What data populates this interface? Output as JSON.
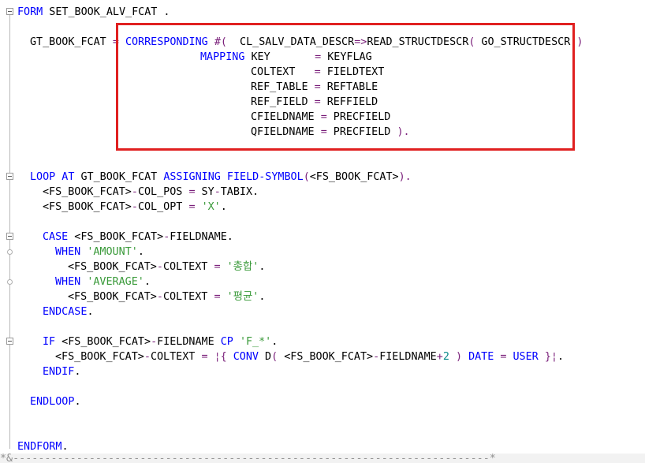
{
  "editor": {
    "lines": [
      {
        "indent": 22,
        "parts": [
          {
            "c": "k",
            "t": "FORM"
          },
          {
            "c": "t",
            "t": " SET_BOOK_ALV_FCAT ."
          }
        ]
      },
      {
        "indent": 38,
        "parts": [
          {
            "c": "t",
            "t": "GT_BOOK_FCAT "
          },
          {
            "c": "p",
            "t": "="
          },
          {
            "c": "t",
            "t": " "
          },
          {
            "c": "k",
            "t": "CORRESPONDING"
          },
          {
            "c": "t",
            "t": " "
          },
          {
            "c": "p",
            "t": "#("
          },
          {
            "c": "t",
            "t": "  CL_SALV_DATA_DESCR"
          },
          {
            "c": "p",
            "t": "=>"
          },
          {
            "c": "t",
            "t": "READ_STRUCTDESCR"
          },
          {
            "c": "p",
            "t": "("
          },
          {
            "c": "t",
            "t": " GO_STRUCTDESCR "
          },
          {
            "c": "p",
            "t": ")"
          }
        ]
      },
      {
        "indent": 254,
        "parts": [
          {
            "c": "k",
            "t": "MAPPING"
          },
          {
            "c": "t",
            "t": " KEY       "
          },
          {
            "c": "p",
            "t": "="
          },
          {
            "c": "t",
            "t": " KEYFLAG"
          }
        ]
      },
      {
        "indent": 318,
        "parts": [
          {
            "c": "t",
            "t": "COLTEXT   "
          },
          {
            "c": "p",
            "t": "="
          },
          {
            "c": "t",
            "t": " FIELDTEXT"
          }
        ]
      },
      {
        "indent": 318,
        "parts": [
          {
            "c": "t",
            "t": "REF_TABLE "
          },
          {
            "c": "p",
            "t": "="
          },
          {
            "c": "t",
            "t": " REFTABLE"
          }
        ]
      },
      {
        "indent": 318,
        "parts": [
          {
            "c": "t",
            "t": "REF_FIELD "
          },
          {
            "c": "p",
            "t": "="
          },
          {
            "c": "t",
            "t": " REFFIELD"
          }
        ]
      },
      {
        "indent": 318,
        "parts": [
          {
            "c": "t",
            "t": "CFIELDNAME "
          },
          {
            "c": "p",
            "t": "="
          },
          {
            "c": "t",
            "t": " PRECFIELD"
          }
        ]
      },
      {
        "indent": 318,
        "parts": [
          {
            "c": "t",
            "t": "QFIELDNAME "
          },
          {
            "c": "p",
            "t": "="
          },
          {
            "c": "t",
            "t": " PRECFIELD "
          },
          {
            "c": "p",
            "t": ")."
          }
        ]
      },
      {
        "indent": 38,
        "parts": [
          {
            "c": "k",
            "t": "LOOP AT"
          },
          {
            "c": "t",
            "t": " GT_BOOK_FCAT "
          },
          {
            "c": "k",
            "t": "ASSIGNING FIELD-SYMBOL"
          },
          {
            "c": "p",
            "t": "("
          },
          {
            "c": "t",
            "t": "<FS_BOOK_FCAT>"
          },
          {
            "c": "p",
            "t": ")."
          }
        ]
      },
      {
        "indent": 54,
        "parts": [
          {
            "c": "t",
            "t": "<FS_BOOK_FCAT>"
          },
          {
            "c": "p",
            "t": "-"
          },
          {
            "c": "t",
            "t": "COL_POS "
          },
          {
            "c": "p",
            "t": "="
          },
          {
            "c": "t",
            "t": " SY"
          },
          {
            "c": "p",
            "t": "-"
          },
          {
            "c": "t",
            "t": "TABIX."
          }
        ]
      },
      {
        "indent": 54,
        "parts": [
          {
            "c": "t",
            "t": "<FS_BOOK_FCAT>"
          },
          {
            "c": "p",
            "t": "-"
          },
          {
            "c": "t",
            "t": "COL_OPT "
          },
          {
            "c": "p",
            "t": "="
          },
          {
            "c": "t",
            "t": " "
          },
          {
            "c": "s",
            "t": "'X'"
          },
          {
            "c": "t",
            "t": "."
          }
        ]
      },
      {
        "indent": 54,
        "parts": [
          {
            "c": "k",
            "t": "CASE"
          },
          {
            "c": "t",
            "t": " <FS_BOOK_FCAT>"
          },
          {
            "c": "p",
            "t": "-"
          },
          {
            "c": "t",
            "t": "FIELDNAME."
          }
        ]
      },
      {
        "indent": 70,
        "parts": [
          {
            "c": "k",
            "t": "WHEN"
          },
          {
            "c": "t",
            "t": " "
          },
          {
            "c": "s",
            "t": "'AMOUNT'"
          },
          {
            "c": "t",
            "t": "."
          }
        ]
      },
      {
        "indent": 86,
        "parts": [
          {
            "c": "t",
            "t": "<FS_BOOK_FCAT>"
          },
          {
            "c": "p",
            "t": "-"
          },
          {
            "c": "t",
            "t": "COLTEXT "
          },
          {
            "c": "p",
            "t": "="
          },
          {
            "c": "t",
            "t": " "
          },
          {
            "c": "s",
            "t": "'총합'"
          },
          {
            "c": "t",
            "t": "."
          }
        ]
      },
      {
        "indent": 70,
        "parts": [
          {
            "c": "k",
            "t": "WHEN"
          },
          {
            "c": "t",
            "t": " "
          },
          {
            "c": "s",
            "t": "'AVERAGE'"
          },
          {
            "c": "t",
            "t": "."
          }
        ]
      },
      {
        "indent": 86,
        "parts": [
          {
            "c": "t",
            "t": "<FS_BOOK_FCAT>"
          },
          {
            "c": "p",
            "t": "-"
          },
          {
            "c": "t",
            "t": "COLTEXT "
          },
          {
            "c": "p",
            "t": "="
          },
          {
            "c": "t",
            "t": " "
          },
          {
            "c": "s",
            "t": "'평균'"
          },
          {
            "c": "t",
            "t": "."
          }
        ]
      },
      {
        "indent": 54,
        "parts": [
          {
            "c": "k",
            "t": "ENDCASE"
          },
          {
            "c": "t",
            "t": "."
          }
        ]
      },
      {
        "indent": 54,
        "parts": [
          {
            "c": "k",
            "t": "IF"
          },
          {
            "c": "t",
            "t": " <FS_BOOK_FCAT>"
          },
          {
            "c": "p",
            "t": "-"
          },
          {
            "c": "t",
            "t": "FIELDNAME "
          },
          {
            "c": "k",
            "t": "CP"
          },
          {
            "c": "t",
            "t": " "
          },
          {
            "c": "s",
            "t": "'F_*'"
          },
          {
            "c": "t",
            "t": "."
          }
        ]
      },
      {
        "indent": 70,
        "parts": [
          {
            "c": "t",
            "t": "<FS_BOOK_FCAT>"
          },
          {
            "c": "p",
            "t": "-"
          },
          {
            "c": "t",
            "t": "COLTEXT "
          },
          {
            "c": "p",
            "t": "="
          },
          {
            "c": "t",
            "t": " "
          },
          {
            "c": "p",
            "t": "¦{"
          },
          {
            "c": "t",
            "t": " "
          },
          {
            "c": "k",
            "t": "CONV"
          },
          {
            "c": "t",
            "t": " D"
          },
          {
            "c": "p",
            "t": "("
          },
          {
            "c": "t",
            "t": " <FS_BOOK_FCAT>"
          },
          {
            "c": "p",
            "t": "-"
          },
          {
            "c": "t",
            "t": "FIELDNAME"
          },
          {
            "c": "p",
            "t": "+"
          },
          {
            "c": "n",
            "t": "2"
          },
          {
            "c": "t",
            "t": " "
          },
          {
            "c": "p",
            "t": ")"
          },
          {
            "c": "t",
            "t": " "
          },
          {
            "c": "k",
            "t": "DATE"
          },
          {
            "c": "t",
            "t": " "
          },
          {
            "c": "p",
            "t": "="
          },
          {
            "c": "t",
            "t": " "
          },
          {
            "c": "k",
            "t": "USER"
          },
          {
            "c": "t",
            "t": " "
          },
          {
            "c": "p",
            "t": "}¦"
          },
          {
            "c": "t",
            "t": "."
          }
        ]
      },
      {
        "indent": 54,
        "parts": [
          {
            "c": "k",
            "t": "ENDIF"
          },
          {
            "c": "t",
            "t": "."
          }
        ]
      },
      {
        "indent": 38,
        "parts": [
          {
            "c": "k",
            "t": "ENDLOOP"
          },
          {
            "c": "t",
            "t": "."
          }
        ]
      },
      {
        "indent": 22,
        "parts": [
          {
            "c": "k",
            "t": "ENDFORM"
          },
          {
            "c": "t",
            "t": "."
          }
        ]
      }
    ],
    "bottom_comment": "*&---------------------------------------------------------------------------*",
    "colors": {
      "keyword": "#0000ff",
      "string": "#3a9a3a",
      "operator": "#7a1f7a",
      "number": "#0a8a8a",
      "highlight_border": "#e02020"
    }
  }
}
